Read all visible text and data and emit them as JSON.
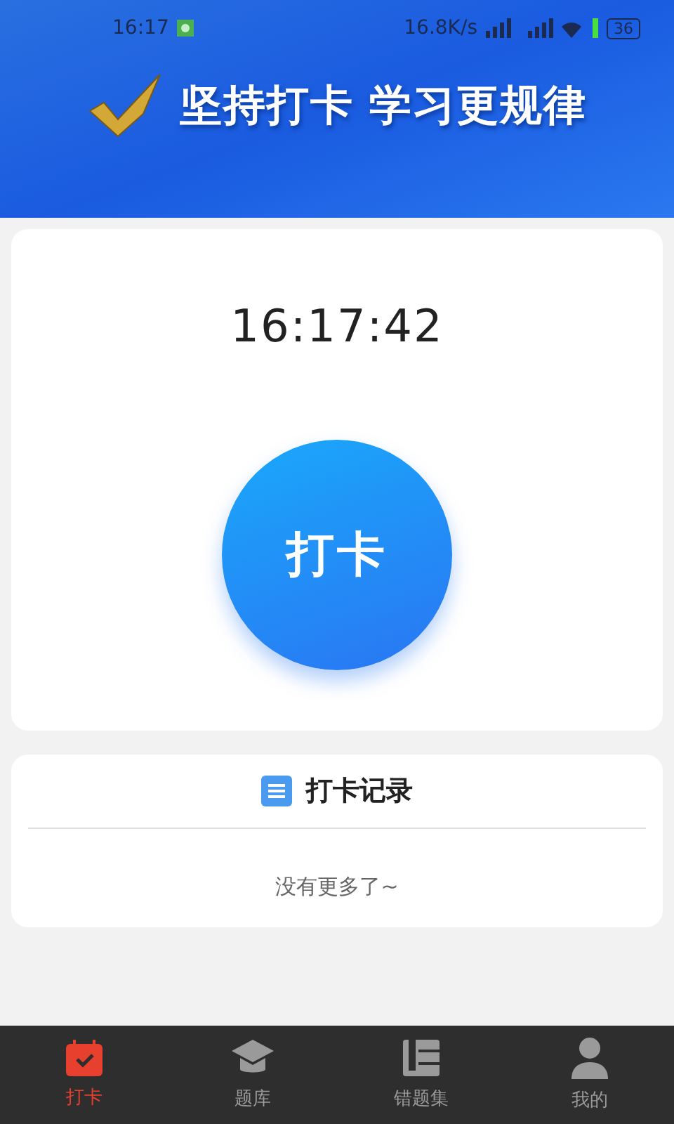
{
  "status_bar": {
    "time": "16:17",
    "speed": "16.8K/s",
    "battery": "36"
  },
  "banner": {
    "title": "坚持打卡 学习更规律"
  },
  "clock": {
    "time": "16:17:42"
  },
  "checkin_button": {
    "label": "打卡"
  },
  "records": {
    "title": "打卡记录",
    "empty_text": "没有更多了~"
  },
  "tabs": [
    {
      "kind": "calendar",
      "label": "打卡",
      "selected": true
    },
    {
      "kind": "cap",
      "label": "题库",
      "selected": false
    },
    {
      "kind": "book",
      "label": "错题集",
      "selected": false
    },
    {
      "kind": "person",
      "label": "我的",
      "selected": false
    }
  ]
}
